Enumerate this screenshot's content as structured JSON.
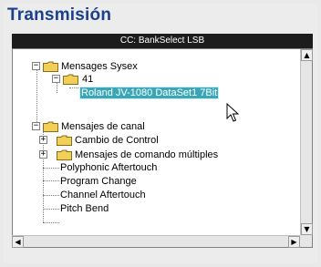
{
  "title": "Transmisión",
  "header": {
    "label": "CC: BankSelect LSB"
  },
  "tree": {
    "mensajes_sysex": {
      "label": "Mensages Sysex",
      "expander": "−"
    },
    "node_41": {
      "label": "41",
      "expander": "−"
    },
    "roland": {
      "label": "Roland JV-1080 DataSet1 7Bit"
    },
    "mensajes_canal": {
      "label": "Mensajes de canal",
      "expander": "−"
    },
    "cambio_control": {
      "label": "Cambio de Control",
      "expander": "+"
    },
    "comando_multiples": {
      "label": "Mensajes de comando múltiples",
      "expander": "+"
    },
    "poly_aftertouch": {
      "label": "Polyphonic Aftertouch"
    },
    "program_change": {
      "label": "Program Change"
    },
    "channel_aftertouch": {
      "label": "Channel Aftertouch"
    },
    "pitch_bend": {
      "label": "Pitch Bend"
    }
  },
  "scroll": {
    "up": "▲",
    "down": "▼",
    "left": "◀",
    "right": "▶"
  },
  "colors": {
    "title": "#1b3f8b",
    "selection": "#3aa6b6",
    "folder": "#f2cf57"
  }
}
